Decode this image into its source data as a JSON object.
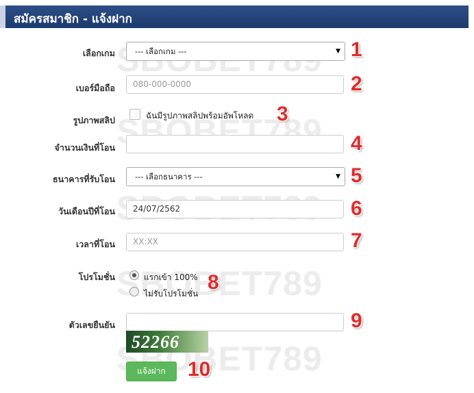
{
  "header": {
    "title": "สมัครสมาชิก - แจ้งฝาก"
  },
  "watermark": "SBOBET789",
  "form": {
    "game": {
      "label": "เลือกเกม",
      "value": "--- เลือกเกม ---"
    },
    "phone": {
      "label": "เบอร์มือถือ",
      "placeholder": "080-000-0000"
    },
    "slip": {
      "label": "รูปภาพสลิป",
      "checkbox_label": "ฉันมีรูปภาพสลิปพร้อมอัพโหลด"
    },
    "amount": {
      "label": "จำนวนเงินที่โอน",
      "value": ""
    },
    "bank": {
      "label": "ธนาคารที่รับโอน",
      "value": "--- เลือกธนาคาร ---"
    },
    "date": {
      "label": "วันเดือนปีที่โอน",
      "value": "24/07/2562"
    },
    "time": {
      "label": "เวลาที่โอน",
      "placeholder": "XX:XX"
    },
    "promo": {
      "label": "โปรโมชั่น",
      "options": [
        "แรกเข้า 100%",
        "ไม่รับโปรโมชั่น"
      ],
      "selected_index": 0
    },
    "captcha": {
      "label": "ตัวเลขยืนยัน",
      "value": "",
      "code": "52266"
    },
    "submit_label": "แจ้งฝาก"
  },
  "annotations": [
    "1",
    "2",
    "3",
    "4",
    "5",
    "6",
    "7",
    "8",
    "9",
    "10"
  ]
}
